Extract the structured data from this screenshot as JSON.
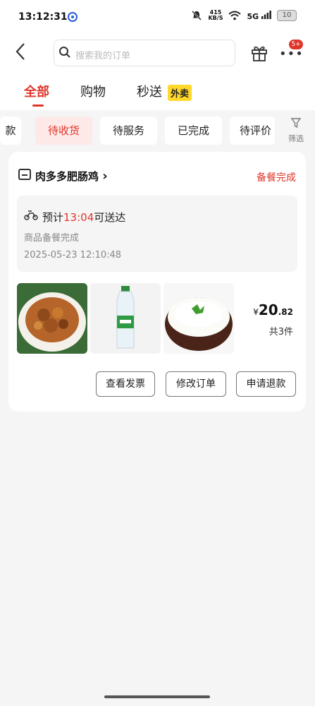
{
  "status_bar": {
    "time": "13:12:31",
    "net_speed_value": "415",
    "net_speed_unit": "KB/S",
    "network": "5G",
    "battery": "10"
  },
  "header": {
    "search_placeholder": "搜索我的订单",
    "notification_badge": "5+"
  },
  "main_tabs": [
    {
      "label": "全部",
      "active": true
    },
    {
      "label": "购物",
      "active": false
    },
    {
      "label": "秒送",
      "active": false
    }
  ],
  "waimai_tag": "外卖",
  "filters": {
    "chips": [
      {
        "label": "款",
        "active": false
      },
      {
        "label": "待收货",
        "active": true
      },
      {
        "label": "待服务",
        "active": false
      },
      {
        "label": "已完成",
        "active": false
      },
      {
        "label": "待评价",
        "active": false
      }
    ],
    "filter_label": "筛选"
  },
  "order": {
    "store_name": "肉多多肥肠鸡",
    "chevron": "›",
    "status": "备餐完成",
    "eta_prefix": "预计",
    "eta_time": "13:04",
    "eta_suffix": "可送达",
    "sub_status": "商品备餐完成",
    "timestamp": "2025-05-23 12:10:48",
    "items": [
      "chicken-dish",
      "water-bottle",
      "rice-bowl"
    ],
    "price_currency": "¥",
    "price_int": "20",
    "price_dec": ".82",
    "count": "共3件",
    "actions": [
      "查看发票",
      "修改订单",
      "申请退款"
    ]
  },
  "colors": {
    "accent": "#e0352b",
    "background": "#f5f5f5",
    "tag_yellow": "#ffd82a"
  }
}
